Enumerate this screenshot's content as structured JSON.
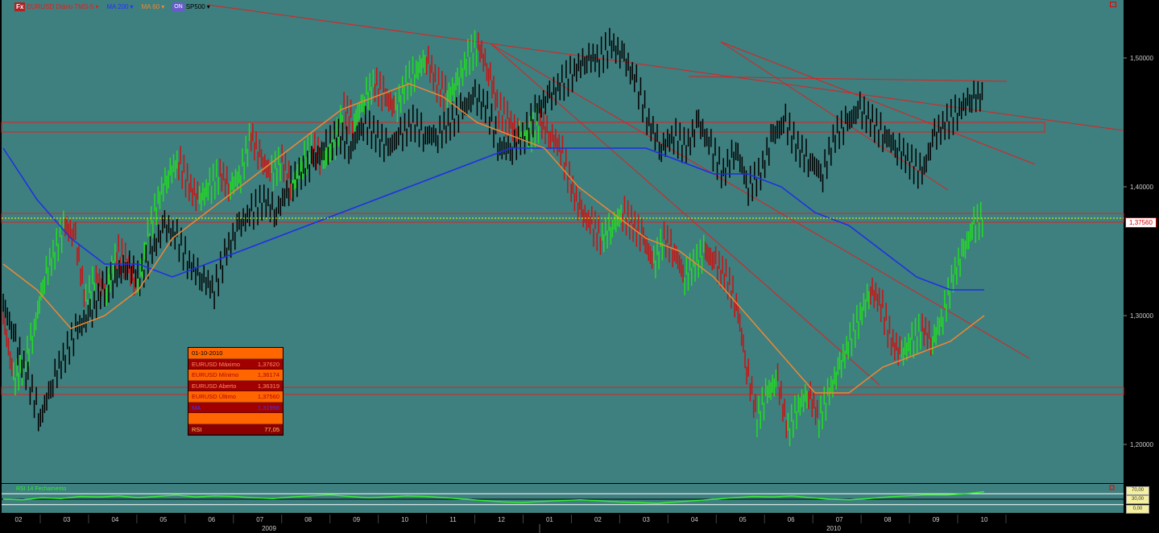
{
  "legend": {
    "fx_badge": "Fx",
    "symbol": "EURUSD Diário TMS-5",
    "ma200": "MA 200",
    "ma60": "MA 60",
    "overlay_badge": "ON",
    "overlay": "SP500",
    "dropdown_glyph": "▾"
  },
  "colors": {
    "background": "#3e7f7f",
    "eurusd_up": "#22dd22",
    "eurusd_down": "#cc1111",
    "sp500": "#000000",
    "ma200": "#1f2ee6",
    "ma60": "#ee8833",
    "trendlines": "#e02020",
    "current_price_line": "#ffff00",
    "rsi_line": "#33ee33"
  },
  "info_box": {
    "date": "01-10-2010",
    "rows": [
      {
        "label": "EURUSD Máximo",
        "value": "1,37620"
      },
      {
        "label": "EURUSD Mínimo",
        "value": "1,36174"
      },
      {
        "label": "EURUSD Aberto",
        "value": "1,36319"
      },
      {
        "label": "EURUSD Último",
        "value": "1,37560"
      }
    ],
    "ma_label": "MA",
    "ma_value": "1,31956",
    "rsi_label": "RSI",
    "rsi_value": "77,05"
  },
  "current_price_label": "1,37560",
  "rsi_panel": {
    "title": "RSI 14 Fechamento",
    "tags": [
      "70,00",
      "30,00",
      "0,00"
    ]
  },
  "chart_data": {
    "type": "line",
    "x_axis": {
      "month_labels": [
        "02",
        "03",
        "04",
        "05",
        "06",
        "07",
        "08",
        "09",
        "10",
        "11",
        "12",
        "01",
        "02",
        "03",
        "04",
        "05",
        "06",
        "07",
        "08",
        "09",
        "10"
      ],
      "year_labels": [
        "2009",
        "2010"
      ]
    },
    "y_axis": {
      "ticks": [
        1.2,
        1.3,
        1.4,
        1.5
      ],
      "tick_labels": [
        "1,20000",
        "1,30000",
        "1,40000",
        "1,50000"
      ],
      "range": [
        1.17,
        1.545
      ],
      "position": "right"
    },
    "series": [
      {
        "name": "EURUSD Diário TMS-5",
        "style": "bars",
        "values": [
          1.3,
          1.25,
          1.26,
          1.29,
          1.33,
          1.35,
          1.37,
          1.36,
          1.31,
          1.33,
          1.32,
          1.35,
          1.34,
          1.32,
          1.36,
          1.39,
          1.41,
          1.42,
          1.4,
          1.39,
          1.4,
          1.41,
          1.4,
          1.41,
          1.44,
          1.42,
          1.41,
          1.42,
          1.4,
          1.42,
          1.43,
          1.42,
          1.43,
          1.46,
          1.45,
          1.47,
          1.48,
          1.47,
          1.46,
          1.48,
          1.49,
          1.5,
          1.48,
          1.47,
          1.48,
          1.5,
          1.51,
          1.49,
          1.46,
          1.45,
          1.44,
          1.44,
          1.45,
          1.44,
          1.43,
          1.4,
          1.38,
          1.37,
          1.36,
          1.37,
          1.38,
          1.37,
          1.36,
          1.34,
          1.36,
          1.35,
          1.33,
          1.34,
          1.35,
          1.34,
          1.33,
          1.31,
          1.26,
          1.22,
          1.24,
          1.25,
          1.21,
          1.23,
          1.24,
          1.22,
          1.24,
          1.26,
          1.28,
          1.3,
          1.32,
          1.31,
          1.28,
          1.27,
          1.28,
          1.29,
          1.28,
          1.3,
          1.33,
          1.35,
          1.37,
          1.376
        ]
      },
      {
        "name": "SP500",
        "style": "bars",
        "values": [
          1.31,
          1.28,
          1.25,
          1.22,
          1.25,
          1.27,
          1.29,
          1.3,
          1.32,
          1.33,
          1.34,
          1.33,
          1.35,
          1.37,
          1.36,
          1.34,
          1.33,
          1.32,
          1.35,
          1.37,
          1.38,
          1.39,
          1.38,
          1.4,
          1.41,
          1.42,
          1.43,
          1.44,
          1.43,
          1.45,
          1.44,
          1.43,
          1.44,
          1.45,
          1.44,
          1.44,
          1.45,
          1.46,
          1.47,
          1.46,
          1.43,
          1.43,
          1.44,
          1.46,
          1.47,
          1.48,
          1.49,
          1.5,
          1.5,
          1.51,
          1.5,
          1.48,
          1.45,
          1.43,
          1.44,
          1.43,
          1.45,
          1.43,
          1.41,
          1.43,
          1.4,
          1.41,
          1.44,
          1.45,
          1.43,
          1.42,
          1.41,
          1.44,
          1.45,
          1.46,
          1.45,
          1.44,
          1.43,
          1.42,
          1.41,
          1.44,
          1.45,
          1.46,
          1.47,
          1.47
        ]
      },
      {
        "name": "MA 200",
        "values": [
          1.43,
          1.39,
          1.36,
          1.34,
          1.34,
          1.33,
          1.34,
          1.35,
          1.36,
          1.37,
          1.38,
          1.39,
          1.4,
          1.41,
          1.42,
          1.43,
          1.43,
          1.43,
          1.43,
          1.43,
          1.42,
          1.41,
          1.41,
          1.4,
          1.38,
          1.37,
          1.35,
          1.33,
          1.32,
          1.32
        ]
      },
      {
        "name": "MA 60",
        "values": [
          1.34,
          1.32,
          1.29,
          1.3,
          1.32,
          1.36,
          1.38,
          1.4,
          1.42,
          1.44,
          1.46,
          1.47,
          1.48,
          1.47,
          1.45,
          1.44,
          1.43,
          1.4,
          1.38,
          1.36,
          1.35,
          1.33,
          1.3,
          1.27,
          1.24,
          1.24,
          1.26,
          1.27,
          1.28,
          1.3
        ]
      }
    ],
    "rsi_series": {
      "name": "RSI 14",
      "values": [
        50,
        48,
        55,
        52,
        60,
        58,
        62,
        55,
        60,
        65,
        58,
        62,
        60,
        55,
        52,
        58,
        62,
        66,
        60,
        55,
        58,
        62,
        60,
        55,
        50,
        45,
        40,
        38,
        42,
        45,
        48,
        44,
        40,
        38,
        35,
        40,
        45,
        50,
        55,
        60,
        58,
        62,
        55,
        50,
        48,
        52,
        58,
        62,
        66,
        65,
        70,
        77
      ]
    },
    "grid": false,
    "legend_position": "top-left"
  }
}
